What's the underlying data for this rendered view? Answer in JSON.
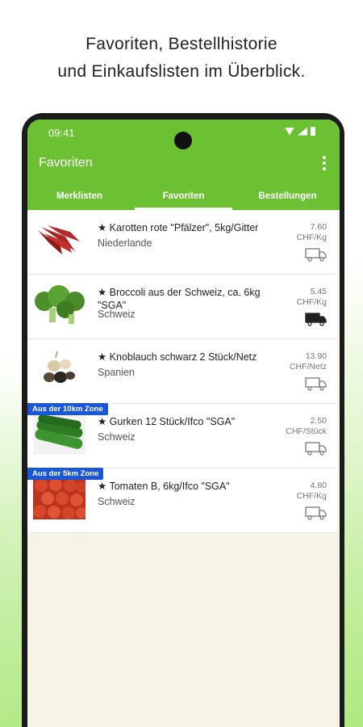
{
  "headline": {
    "line1": "Favoriten, Bestellhistorie",
    "line2": "und Einkaufslisten im Überblick."
  },
  "status_bar": {
    "time": "09:41"
  },
  "app_bar": {
    "title": "Favoriten"
  },
  "tabs": [
    {
      "label": "Merklisten",
      "active": false
    },
    {
      "label": "Favoriten",
      "active": true
    },
    {
      "label": "Bestellungen",
      "active": false
    }
  ],
  "items": [
    {
      "name": "★ Karotten  rote \"Pfälzer\", 5kg/Gitter",
      "origin": "Niederlande",
      "price": "7.60",
      "unit": "CHF/Kg",
      "truck_filled": false,
      "zone": "",
      "image": "carrot-image"
    },
    {
      "name": "★ Broccoli aus der Schweiz, ca. 6kg \"SGA\"",
      "origin": "Schweiz",
      "price": "5.45",
      "unit": "CHF/Kg",
      "truck_filled": true,
      "zone": "",
      "image": "broccoli-image"
    },
    {
      "name": "★ Knoblauch schwarz 2 Stück/Netz",
      "origin": "Spanien",
      "price": "13.90",
      "unit": "CHF/Netz",
      "truck_filled": false,
      "zone": "",
      "image": "garlic-image"
    },
    {
      "name": "★ Gurken 12 Stück/Ifco \"SGA\"",
      "origin": "Schweiz",
      "price": "2.50",
      "unit": "CHF/Stück",
      "truck_filled": false,
      "zone": "Aus der 10km Zone",
      "image": "cucumber-image"
    },
    {
      "name": "★ Tomaten B, 6kg/Ifco \"SGA\"",
      "origin": "Schweiz",
      "price": "4.80",
      "unit": "CHF/Kg",
      "truck_filled": false,
      "zone": "Aus der 5km Zone",
      "image": "tomato-image"
    }
  ],
  "colors": {
    "brand_green": "#6cc133",
    "zone_badge_blue": "#1a57d6",
    "list_background": "#f5f4e6"
  }
}
